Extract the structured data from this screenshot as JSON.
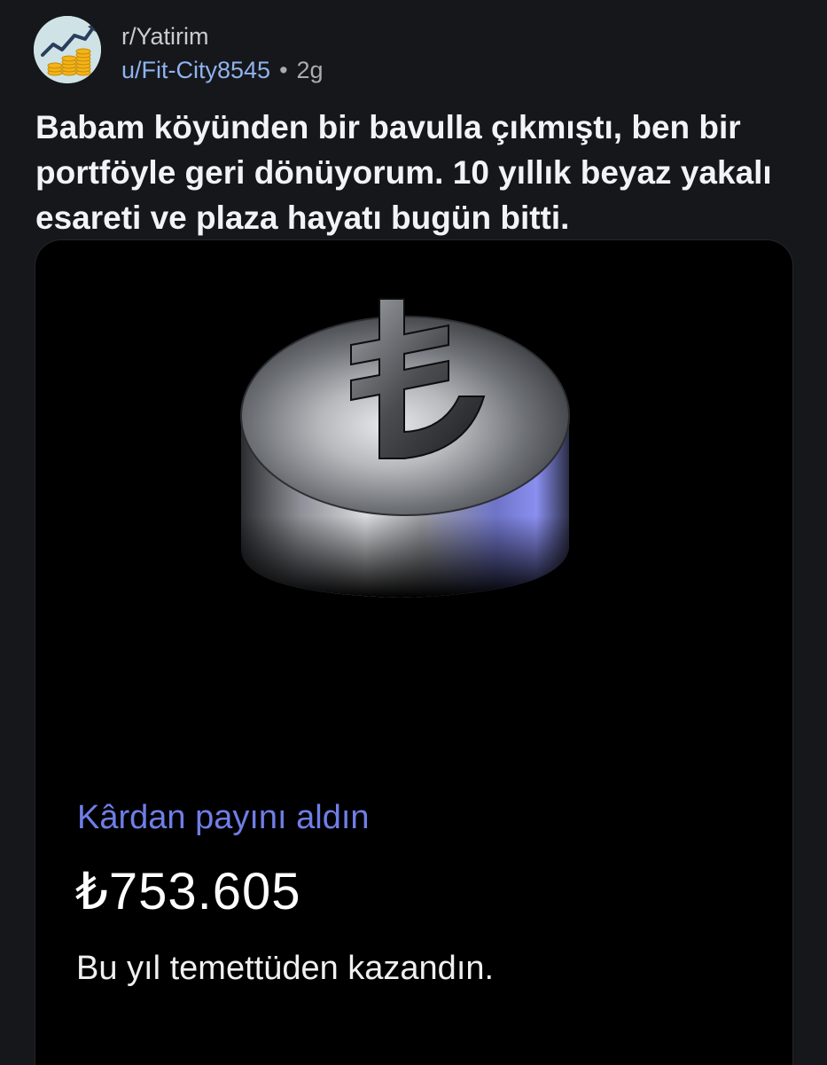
{
  "post": {
    "subreddit": "r/Yatirim",
    "username": "u/Fit-City8545",
    "separator": "•",
    "age": "2g",
    "title": "Babam köyünden bir bavulla çıkmıştı, ben bir portföyle geri dönüyorum. 10 yıllık beyaz yakalı esareti ve plaza hayatı bugün bitti."
  },
  "card": {
    "icon": "turkish-lira-coin-icon",
    "label": "Kârdan payını aldın",
    "amount": "₺753.605",
    "subtitle": "Bu yıl temettüden kazandın."
  },
  "colors": {
    "background": "#16171b",
    "card_background": "#000000",
    "username": "#8fb3ee",
    "label_accent": "#6f7ee6",
    "avatar_background": "#cfe3e6"
  }
}
